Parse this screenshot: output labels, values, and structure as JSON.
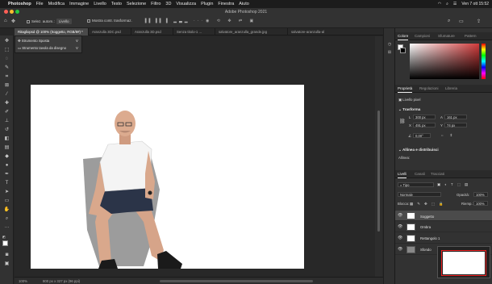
{
  "menubar": {
    "app": "Photoshop",
    "items": [
      "File",
      "Modifica",
      "Immagine",
      "Livello",
      "Testo",
      "Selezione",
      "Filtro",
      "3D",
      "Visualizza",
      "Plugin",
      "Finestra",
      "Aiuto"
    ],
    "datetime": "Ven 7 ott 15:52"
  },
  "window": {
    "title": "Adobe Photoshop 2021"
  },
  "options": {
    "auto_select_label": "Selez. autom.:",
    "auto_select_value": "Livello",
    "show_transform_label": "Mostra contr. trasformaz."
  },
  "tabs": [
    {
      "label": "Ritagliopsd @ 100% (Soggetto, RGB/8#) *",
      "active": true
    },
    {
      "label": "Aranzulla 3DC.psd",
      "active": false
    },
    {
      "label": "Aranzulla 3D.psd",
      "active": false
    },
    {
      "label": "Senza titolo-1 ...",
      "active": false
    },
    {
      "label": "salvatore_aranzulla_grande.jpg",
      "active": false
    },
    {
      "label": "salvatore-aranzulla-al",
      "active": false
    }
  ],
  "flyout": {
    "items": [
      "Strumento Sposta",
      "Strumento tavola da disegno"
    ],
    "shortcut": "V"
  },
  "status": {
    "zoom": "100%",
    "docinfo": "800 px x 327 px (96 ppi)"
  },
  "color_panel": {
    "tabs": [
      "Colore",
      "Campioni",
      "Sfumature",
      "Pattern"
    ],
    "accent": "#d23b3b"
  },
  "properties_panel": {
    "tabs": [
      "Proprietà",
      "Regolazioni",
      "Libreria"
    ],
    "layer_kind": "Livello pixel",
    "transform_title": "Trasforma",
    "W": "300 px",
    "H": "161 px",
    "X": "491 px",
    "Y": "74 px",
    "angle": "0,00°",
    "align_title": "Allinea e distribuisci",
    "align_label": "Allinea:"
  },
  "layers_panel": {
    "tabs": [
      "Livelli",
      "Canali",
      "Tracciati"
    ],
    "filter": "Tipo",
    "blend_mode": "Normale",
    "opacity_label": "Opacità:",
    "opacity": "100%",
    "lock_label": "Blocca:",
    "fill_label": "Riemp.:",
    "fill": "100%",
    "layers": [
      {
        "name": "Soggetto",
        "selected": true
      },
      {
        "name": "Ombra",
        "selected": false
      },
      {
        "name": "Rettangolo 1",
        "selected": false
      },
      {
        "name": "Sfondo",
        "selected": false
      }
    ]
  }
}
